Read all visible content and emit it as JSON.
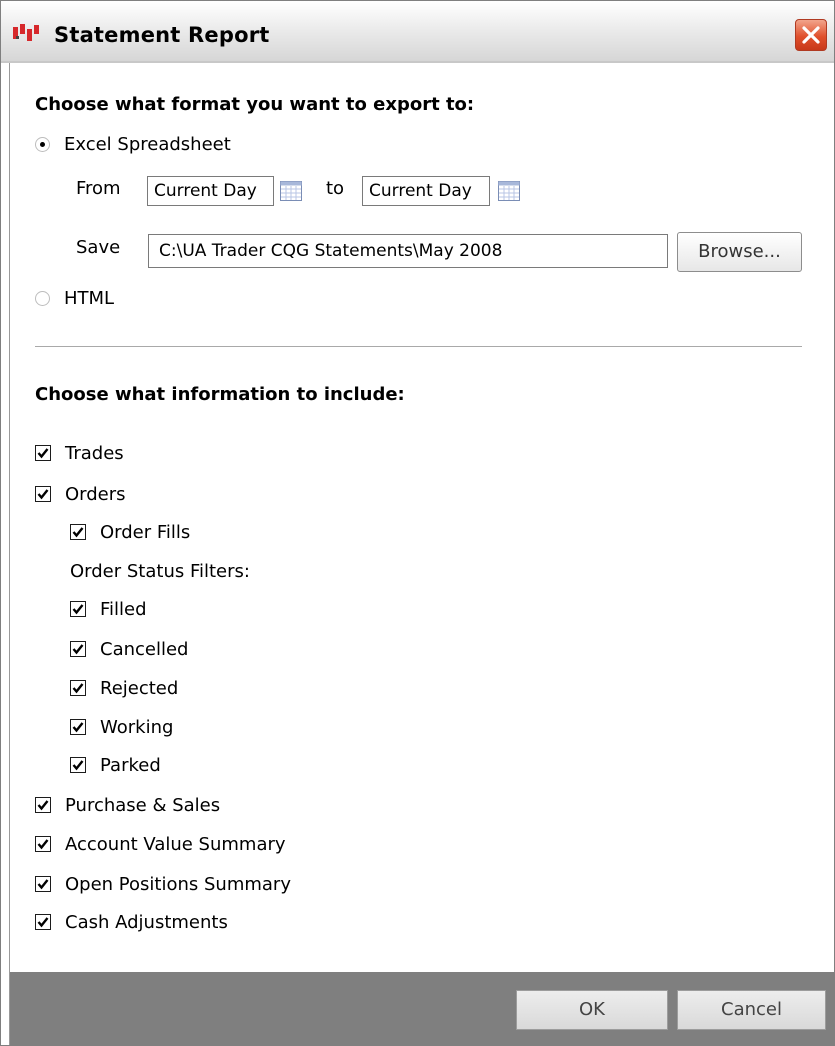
{
  "window": {
    "title": "Statement Report",
    "close_icon": "close-icon",
    "app_icon": "app-icon"
  },
  "export_format": {
    "heading": "Choose what format you want to export to:",
    "excel_label": "Excel Spreadsheet",
    "excel_selected": true,
    "from_label": "From",
    "from_value": "Current Day",
    "to_label": "to",
    "to_value": "Current Day",
    "calendar_icon": "calendar-icon",
    "save_label": "Save",
    "save_path": "C:\\UA Trader CQG Statements\\May 2008",
    "browse_label": "Browse...",
    "html_label": "HTML",
    "html_selected": false
  },
  "include": {
    "heading": "Choose what information to include:",
    "trades": {
      "label": "Trades",
      "checked": true
    },
    "orders": {
      "label": "Orders",
      "checked": true
    },
    "order_fills": {
      "label": "Order Fills",
      "checked": true
    },
    "status_filters_label": "Order Status Filters:",
    "filled": {
      "label": "Filled",
      "checked": true
    },
    "cancelled": {
      "label": "Cancelled",
      "checked": true
    },
    "rejected": {
      "label": "Rejected",
      "checked": true
    },
    "working": {
      "label": "Working",
      "checked": true
    },
    "parked": {
      "label": "Parked",
      "checked": true
    },
    "purchase_sales": {
      "label": "Purchase & Sales",
      "checked": true
    },
    "account_value": {
      "label": "Account Value Summary",
      "checked": true
    },
    "open_positions": {
      "label": "Open Positions Summary",
      "checked": true
    },
    "cash_adjustments": {
      "label": "Cash Adjustments",
      "checked": true
    }
  },
  "footer": {
    "ok_label": "OK",
    "cancel_label": "Cancel"
  },
  "colors": {
    "footer_bg": "#7f7f7f",
    "close_red": "#e0502c"
  }
}
